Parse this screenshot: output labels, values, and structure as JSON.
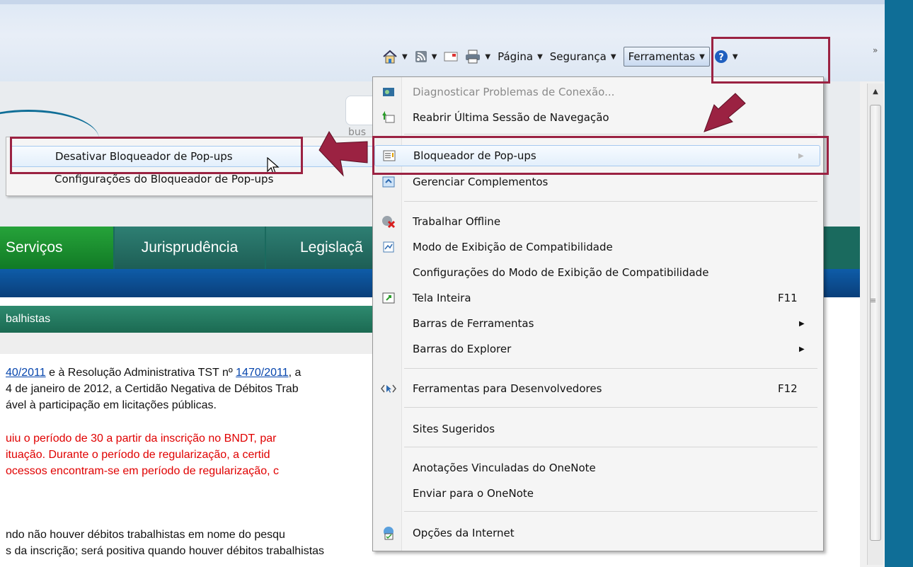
{
  "toolbar": {
    "pagina": "Página",
    "seguranca": "Segurança",
    "ferramentas": "Ferramentas",
    "overflow": "»"
  },
  "page": {
    "search_label": "bus",
    "nav": [
      "Serviços",
      "Jurisprudência",
      "Legislaçã"
    ],
    "section_title": "balhistas",
    "lines": {
      "l1a": "40/2011",
      "l1b": " e à Resolução Administrativa TST nº ",
      "l1c": "1470/2011",
      "l1d": ", a",
      "l2": "4 de janeiro de 2012, a Certidão Negativa de Débitos Trab",
      "l3": "ável à participação em licitações públicas.",
      "r1": "uiu o período de 30 a partir da inscrição no BNDT, par",
      "r2": "ituação. Durante o período de regularização, a certid",
      "r3": "ocessos encontram-se em período de regularização, c",
      "b1": "ndo não houver débitos trabalhistas em nome do pesqu",
      "b2": "s da inscrição; será positiva quando houver débitos trabalhistas"
    }
  },
  "submenu": {
    "items": [
      "Desativar Bloqueador de Pop-ups",
      "Configurações do Bloqueador de Pop-ups"
    ]
  },
  "menu": {
    "items": [
      {
        "label": "Diagnosticar Problemas de Conexão...",
        "key": "",
        "icon": "network-diagnose-icon"
      },
      {
        "label": "Reabrir Última Sessão de Navegação",
        "key": "",
        "icon": "reopen-session-icon"
      },
      {
        "label": "Bloqueador de Pop-ups",
        "key": "",
        "icon": "popup-blocker-icon"
      },
      {
        "label": "Gerenciar Complementos",
        "key": "",
        "icon": "addons-icon"
      },
      {
        "label": "Trabalhar Offline",
        "key": "",
        "icon": "offline-icon"
      },
      {
        "label": "Modo de Exibição de Compatibilidade",
        "key": "",
        "icon": "compatibility-icon"
      },
      {
        "label": "Configurações do Modo de Exibição de Compatibilidade",
        "key": ""
      },
      {
        "label": "Tela Inteira",
        "key": "F11",
        "icon": "fullscreen-icon"
      },
      {
        "label": "Barras de Ferramentas",
        "key": ""
      },
      {
        "label": "Barras do Explorer",
        "key": ""
      },
      {
        "label": "Ferramentas para Desenvolvedores",
        "key": "F12",
        "icon": "developer-tools-icon"
      },
      {
        "label": "Sites Sugeridos",
        "key": ""
      },
      {
        "label": "Anotações Vinculadas do OneNote",
        "key": ""
      },
      {
        "label": "Enviar para o OneNote",
        "key": ""
      },
      {
        "label": "Opções da Internet",
        "key": "",
        "icon": "internet-options-icon"
      }
    ]
  },
  "colors": {
    "highlight": "#9b2242",
    "frame": "#0f6e97",
    "nav_green": "#117a25",
    "nav_teal": "#1d5e55",
    "red_text": "#e00000"
  }
}
